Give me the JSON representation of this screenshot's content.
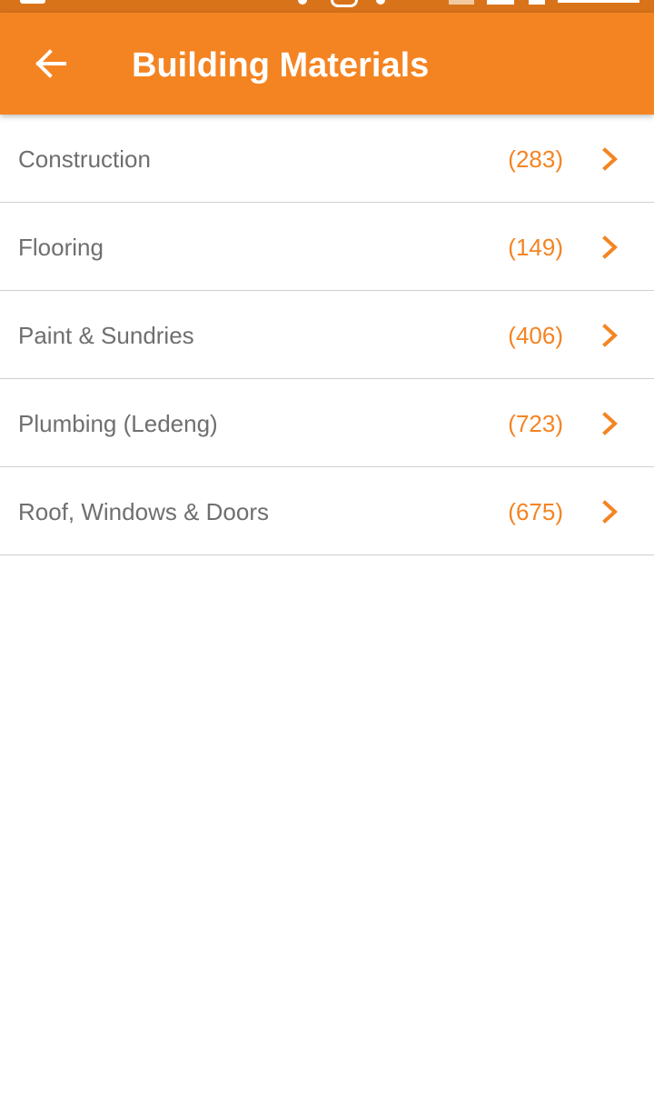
{
  "colors": {
    "accent": "#f48422",
    "status_bar": "#d9731a",
    "label_text": "#6f6f6f",
    "divider": "#cfcfcf"
  },
  "header": {
    "title": "Building Materials",
    "back_icon": "arrow-left-icon"
  },
  "categories": [
    {
      "label": "Construction",
      "count": "(283)"
    },
    {
      "label": "Flooring",
      "count": "(149)"
    },
    {
      "label": "Paint & Sundries",
      "count": "(406)"
    },
    {
      "label": "Plumbing (Ledeng)",
      "count": "(723)"
    },
    {
      "label": "Roof, Windows & Doors",
      "count": "(675)"
    }
  ],
  "row_icon": "chevron-right-icon"
}
